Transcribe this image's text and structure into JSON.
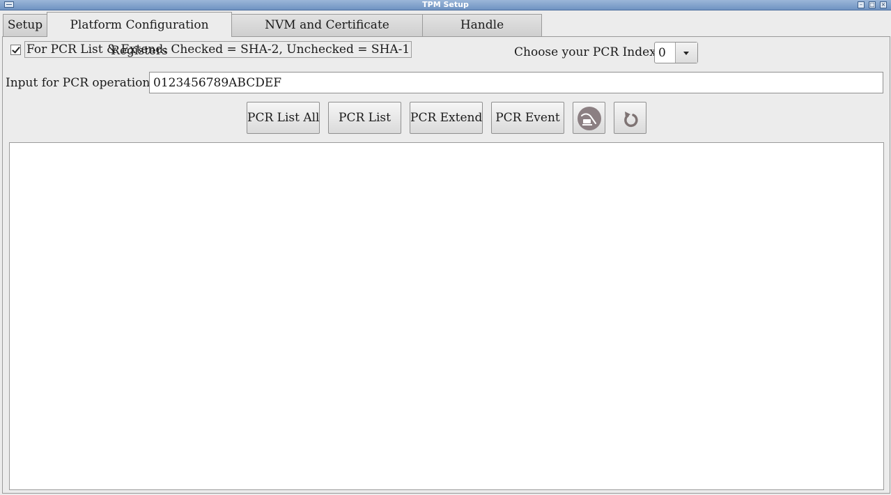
{
  "window": {
    "title": "TPM Setup"
  },
  "tabs": [
    {
      "label": "Setup"
    },
    {
      "label": "Platform Configuration Registers"
    },
    {
      "label": "NVM and Certificate Management"
    },
    {
      "label": "Handle Management"
    }
  ],
  "pcr": {
    "hash_checkbox_label": "For PCR List & Extend: Checked = SHA-2, Unchecked = SHA-1",
    "hash_checkbox_checked": true,
    "index_label": "Choose your PCR Index:",
    "index_value": "0",
    "input_label": "Input for PCR operations:",
    "input_value": "0123456789ABCDEF"
  },
  "buttons": {
    "list_all": "PCR List All",
    "list": "PCR List",
    "extend": "PCR Extend",
    "event": "PCR Event"
  },
  "icons": {
    "clear": "clear-output-icon",
    "reset": "reset-icon"
  },
  "colors": {
    "window_bg": "#ececec",
    "icon_fill": "#8b7f82"
  }
}
